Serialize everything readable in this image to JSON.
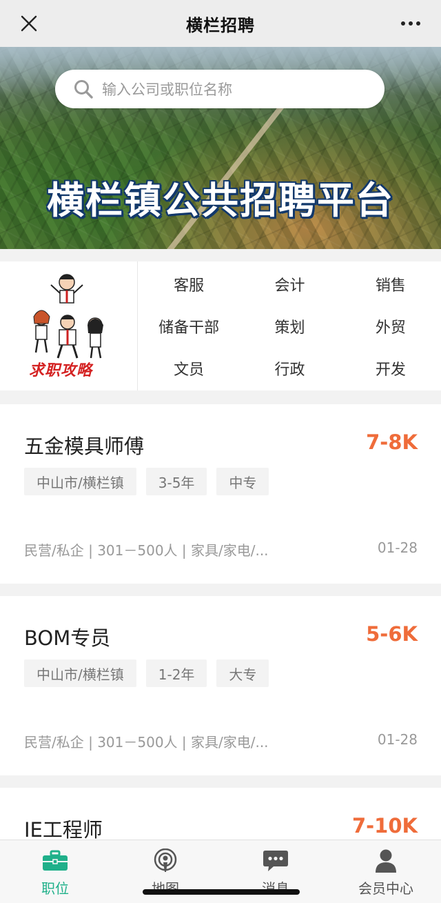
{
  "titlebar": {
    "title": "横栏招聘",
    "close_icon": "close-icon",
    "more_icon": "more-icon"
  },
  "search": {
    "placeholder": "输入公司或职位名称",
    "icon": "search-icon"
  },
  "banner": {
    "title": "横栏镇公共招聘平台"
  },
  "guide": {
    "label": "求职攻略"
  },
  "categories": [
    "客服",
    "会计",
    "销售",
    "储备干部",
    "策划",
    "外贸",
    "文员",
    "行政",
    "开发"
  ],
  "jobs": [
    {
      "title": "五金模具师傅",
      "salary": "7-8K",
      "tags": [
        "中山市/横栏镇",
        "3-5年",
        "中专"
      ],
      "meta": "民营/私企 | 301－500人 | 家具/家电/...",
      "date": "01-28"
    },
    {
      "title": "BOM专员",
      "salary": "5-6K",
      "tags": [
        "中山市/横栏镇",
        "1-2年",
        "大专"
      ],
      "meta": "民营/私企 | 301－500人 | 家具/家电/...",
      "date": "01-28"
    },
    {
      "title": "IE工程师",
      "salary": "7-10K"
    }
  ],
  "bottom_nav": [
    {
      "label": "职位",
      "icon": "briefcase-icon",
      "active": true
    },
    {
      "label": "地图",
      "icon": "location-icon",
      "active": false
    },
    {
      "label": "消息",
      "icon": "chat-bubble-icon",
      "active": false
    },
    {
      "label": "会员中心",
      "icon": "person-icon",
      "active": false
    }
  ],
  "colors": {
    "accent_green": "#1fb08a",
    "salary_orange": "#ef6c3a",
    "banner_title_outline": "#12386b"
  }
}
